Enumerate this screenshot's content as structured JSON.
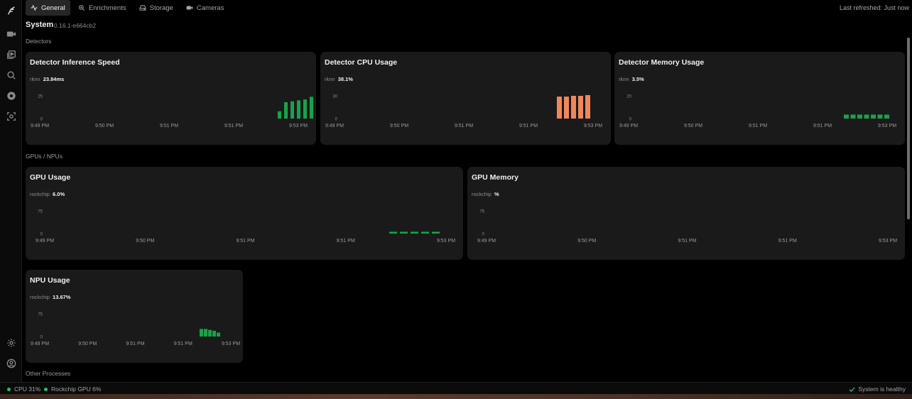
{
  "tabs": [
    {
      "label": "General",
      "icon": "activity-icon",
      "active": true
    },
    {
      "label": "Enrichments",
      "icon": "search-sparkle-icon",
      "active": false
    },
    {
      "label": "Storage",
      "icon": "hard-drive-icon",
      "active": false
    },
    {
      "label": "Cameras",
      "icon": "video-icon",
      "active": false
    }
  ],
  "last_refreshed": "Last refreshed: Just now",
  "system": {
    "title": "System",
    "version": "0.16.1-e664cb2"
  },
  "sections": {
    "detectors": "Detectors",
    "gpus": "GPUs / NPUs",
    "other": "Other Processes"
  },
  "cards": {
    "inference": {
      "title": "Detector Inference Speed",
      "series": "rknn",
      "value": "23.84ms"
    },
    "cpu": {
      "title": "Detector CPU Usage",
      "series": "rknn",
      "value": "38.1%"
    },
    "memory": {
      "title": "Detector Memory Usage",
      "series": "rknn",
      "value": "3.5%"
    },
    "gpu_usage": {
      "title": "GPU Usage",
      "series": "rockchip",
      "value": "6.0%"
    },
    "gpu_memory": {
      "title": "GPU Memory",
      "series": "rockchip",
      "value": "%"
    },
    "npu": {
      "title": "NPU Usage",
      "series": "rockchip",
      "value": "13.67%"
    }
  },
  "chart_data": [
    {
      "id": "inference",
      "type": "bar",
      "color": "#16a34a",
      "x_ticks": [
        "9:49 PM",
        "9:50 PM",
        "9:51 PM",
        "9:51 PM",
        "9:53 PM"
      ],
      "y_ticks": [
        0,
        25
      ],
      "ylim": [
        0,
        25
      ],
      "values": [
        8,
        18,
        19,
        20,
        21,
        24
      ]
    },
    {
      "id": "cpu",
      "type": "bar",
      "color": "#f0875a",
      "x_ticks": [
        "9:49 PM",
        "9:50 PM",
        "9:51 PM",
        "9:51 PM",
        "9:53 PM"
      ],
      "y_ticks": [
        0,
        30
      ],
      "ylim": [
        0,
        30
      ],
      "values": [
        29,
        29,
        30,
        30,
        31
      ]
    },
    {
      "id": "memory",
      "type": "bar",
      "color": "#16a34a",
      "x_ticks": [
        "9:49 PM",
        "9:50 PM",
        "9:51 PM",
        "9:51 PM",
        "9:53 PM"
      ],
      "y_ticks": [
        0,
        20
      ],
      "ylim": [
        0,
        20
      ],
      "values": [
        3.5,
        3.5,
        3.5,
        3.5,
        3.5,
        3.5,
        3.5
      ]
    },
    {
      "id": "gpu_usage",
      "type": "bar",
      "color": "#16a34a",
      "x_ticks": [
        "9:49 PM",
        "9:50 PM",
        "9:51 PM",
        "9:51 PM",
        "9:53 PM"
      ],
      "y_ticks": [
        0,
        75
      ],
      "ylim": [
        0,
        75
      ],
      "values": [
        6,
        6,
        6,
        6,
        6
      ]
    },
    {
      "id": "gpu_memory",
      "type": "bar",
      "color": "#16a34a",
      "x_ticks": [
        "9:49 PM",
        "9:50 PM",
        "9:51 PM",
        "9:51 PM",
        "9:53 PM"
      ],
      "y_ticks": [
        0,
        75
      ],
      "ylim": [
        0,
        75
      ],
      "values": []
    },
    {
      "id": "npu",
      "type": "bar",
      "color": "#16a34a",
      "x_ticks": [
        "9:49 PM",
        "9:50 PM",
        "9:51 PM",
        "9:51 PM",
        "9:53 PM"
      ],
      "y_ticks": [
        0,
        75
      ],
      "ylim": [
        0,
        75
      ],
      "values": [
        25,
        25,
        22,
        19,
        13
      ]
    }
  ],
  "status": {
    "cpu": "CPU 31%",
    "gpu": "Rockchip GPU 6%",
    "health": "System is healthy"
  }
}
